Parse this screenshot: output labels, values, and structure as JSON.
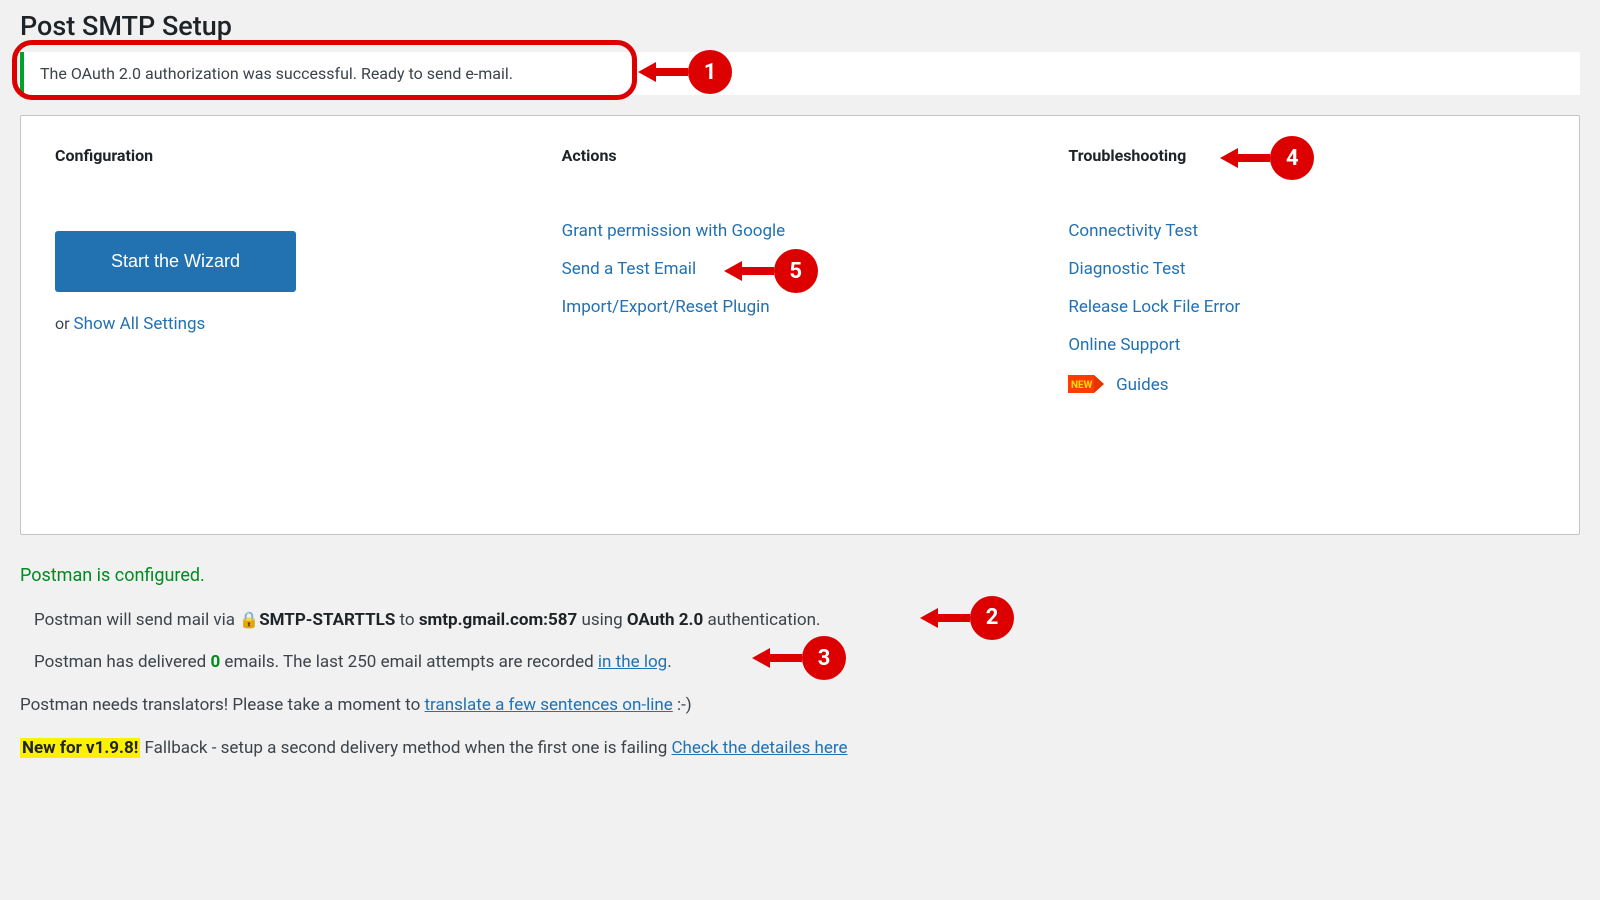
{
  "page": {
    "title": "Post SMTP Setup"
  },
  "notice": {
    "text": "The OAuth 2.0 authorization was successful. Ready to send e-mail."
  },
  "columns": {
    "configuration": {
      "title": "Configuration",
      "wizard_button": "Start the Wizard",
      "or_text": "or ",
      "show_all_link": "Show All Settings"
    },
    "actions": {
      "title": "Actions",
      "links": [
        "Grant permission with Google",
        "Send a Test Email",
        "Import/Export/Reset Plugin"
      ]
    },
    "troubleshooting": {
      "title": "Troubleshooting",
      "links": [
        "Connectivity Test",
        "Diagnostic Test",
        "Release Lock File Error",
        "Online Support"
      ],
      "new_badge": "NEW",
      "guides_link": "Guides"
    }
  },
  "status": {
    "heading": "Postman is configured.",
    "line1": {
      "prefix": "Postman will send mail via ",
      "protocol": "SMTP-STARTTLS",
      "mid1": " to ",
      "host": "smtp.gmail.com:587",
      "mid2": " using ",
      "auth": "OAuth 2.0",
      "suffix": " authentication."
    },
    "line2": {
      "prefix": "Postman has delivered ",
      "count": "0",
      "mid": " emails. The last 250 email attempts are recorded ",
      "link": "in the log",
      "suffix": "."
    }
  },
  "footer": {
    "translate": {
      "prefix": "Postman needs translators! Please take a moment to ",
      "link": "translate a few sentences on-line",
      "suffix": " :-)"
    },
    "fallback": {
      "badge": "New for v1.9.8!",
      "text": " Fallback - setup a second delivery method when the first one is failing ",
      "link": "Check the detailes here"
    }
  },
  "callouts": {
    "c1": "1",
    "c2": "2",
    "c3": "3",
    "c4": "4",
    "c5": "5"
  },
  "colors": {
    "accent": "#2271b1",
    "success": "#00a32a",
    "callout": "#dd0000"
  }
}
